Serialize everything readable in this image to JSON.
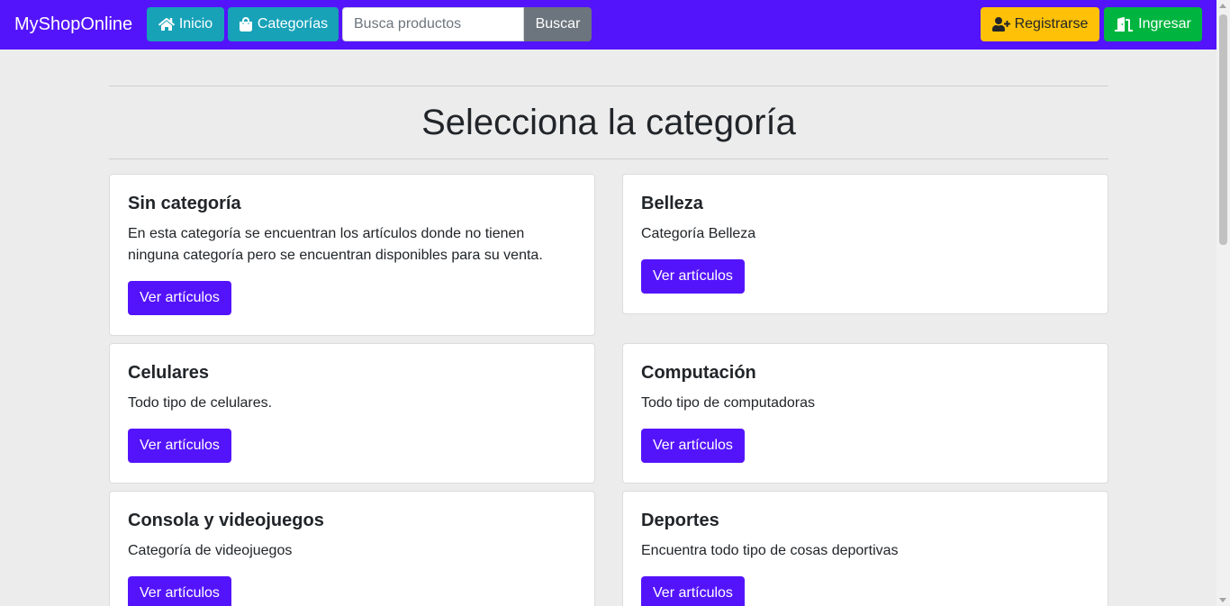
{
  "navbar": {
    "brand": "MyShopOnline",
    "home_label": "Inicio",
    "home_icon": "home-icon",
    "categories_label": "Categorías",
    "categories_icon": "shopping-bag-icon",
    "search_placeholder": "Busca productos",
    "search_value": "",
    "search_button": "Buscar",
    "register_label": "Registrarse",
    "register_icon": "user-plus-icon",
    "login_label": "Ingresar",
    "login_icon": "door-open-icon",
    "colors": {
      "brand": "#5414fb",
      "info": "#17a2b8",
      "secondary": "#6c757d",
      "warning": "#ffc107",
      "success": "#00b53f"
    }
  },
  "main": {
    "title": "Selecciona la categoría",
    "categories": [
      {
        "name": "Sin categoría",
        "description": "En esta categoría se encuentran los artículos donde no tienen ninguna categoría pero se encuentran disponibles para su venta.",
        "button": "Ver artículos"
      },
      {
        "name": "Belleza",
        "description": "Categoría Belleza",
        "button": "Ver artículos"
      },
      {
        "name": "Celulares",
        "description": "Todo tipo de celulares.",
        "button": "Ver artículos"
      },
      {
        "name": "Computación",
        "description": "Todo tipo de computadoras",
        "button": "Ver artículos"
      },
      {
        "name": "Consola y videojuegos",
        "description": "Categoría de videojuegos",
        "button": "Ver artículos"
      },
      {
        "name": "Deportes",
        "description": "Encuentra todo tipo de cosas deportivas",
        "button": "Ver artículos"
      }
    ]
  }
}
